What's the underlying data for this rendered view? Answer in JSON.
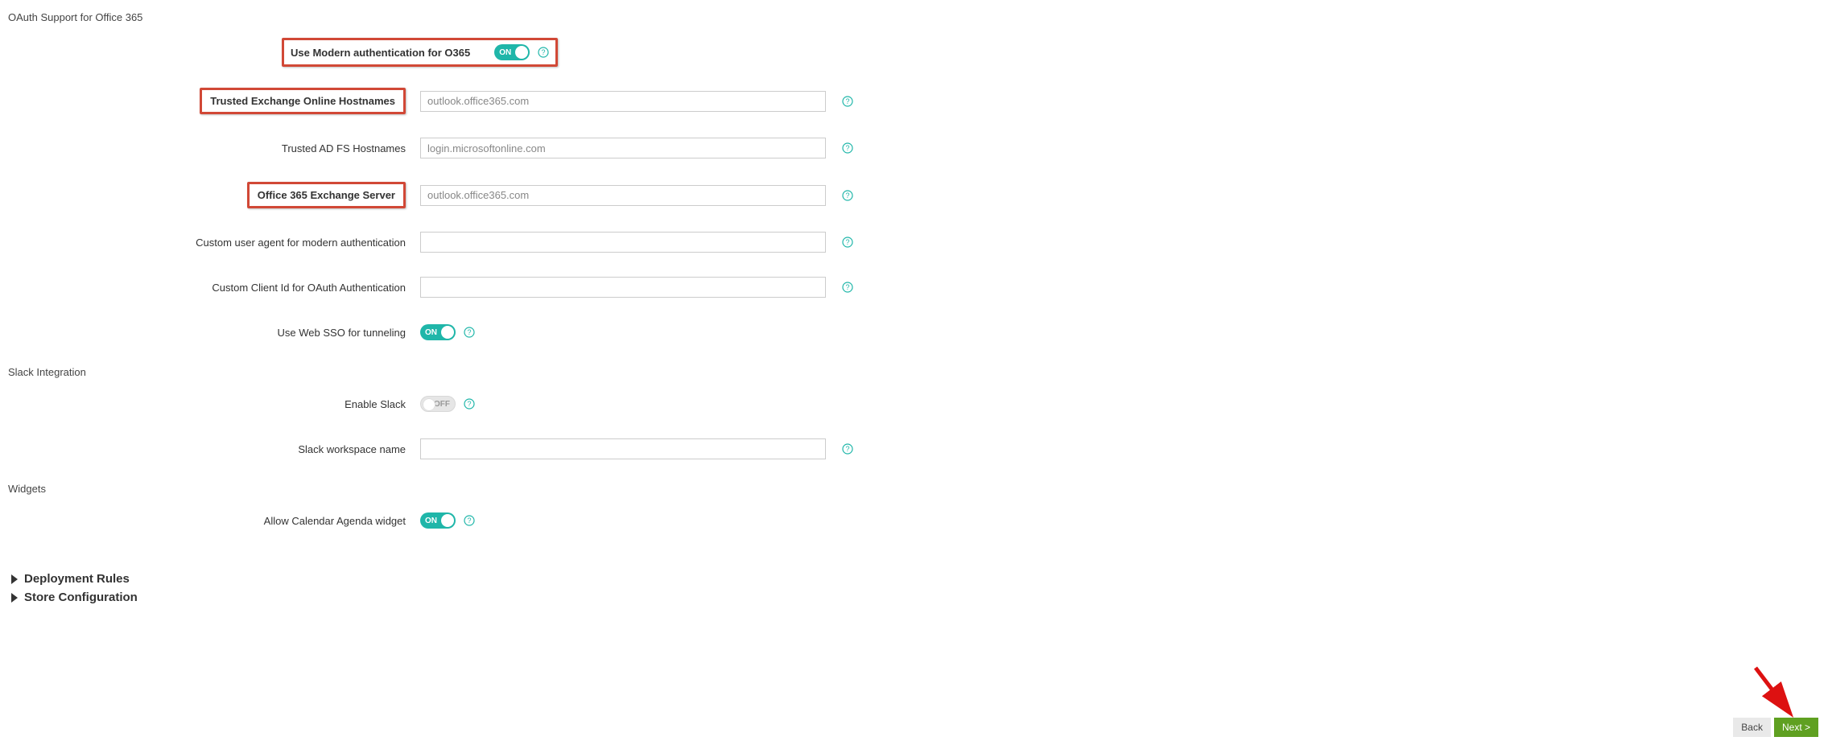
{
  "sections": {
    "oauth_header": "OAuth Support for Office 365",
    "slack_header": "Slack Integration",
    "widgets_header": "Widgets"
  },
  "fields": {
    "modern_auth": {
      "label": "Use Modern authentication for O365",
      "state": "ON"
    },
    "trusted_exchange": {
      "label": "Trusted Exchange Online Hostnames",
      "placeholder": "outlook.office365.com"
    },
    "trusted_adfs": {
      "label": "Trusted AD FS Hostnames",
      "placeholder": "login.microsoftonline.com"
    },
    "o365_exchange_server": {
      "label": "Office 365 Exchange Server",
      "placeholder": "outlook.office365.com"
    },
    "custom_user_agent": {
      "label": "Custom user agent for modern authentication",
      "value": ""
    },
    "custom_client_id": {
      "label": "Custom Client Id for OAuth Authentication",
      "value": ""
    },
    "web_sso": {
      "label": "Use Web SSO for tunneling",
      "state": "ON"
    },
    "enable_slack": {
      "label": "Enable Slack",
      "state": "OFF"
    },
    "slack_workspace": {
      "label": "Slack workspace name",
      "value": ""
    },
    "calendar_widget": {
      "label": "Allow Calendar Agenda widget",
      "state": "ON"
    }
  },
  "accordions": {
    "deployment_rules": "Deployment Rules",
    "store_configuration": "Store Configuration"
  },
  "buttons": {
    "back": "Back",
    "next": "Next >"
  }
}
